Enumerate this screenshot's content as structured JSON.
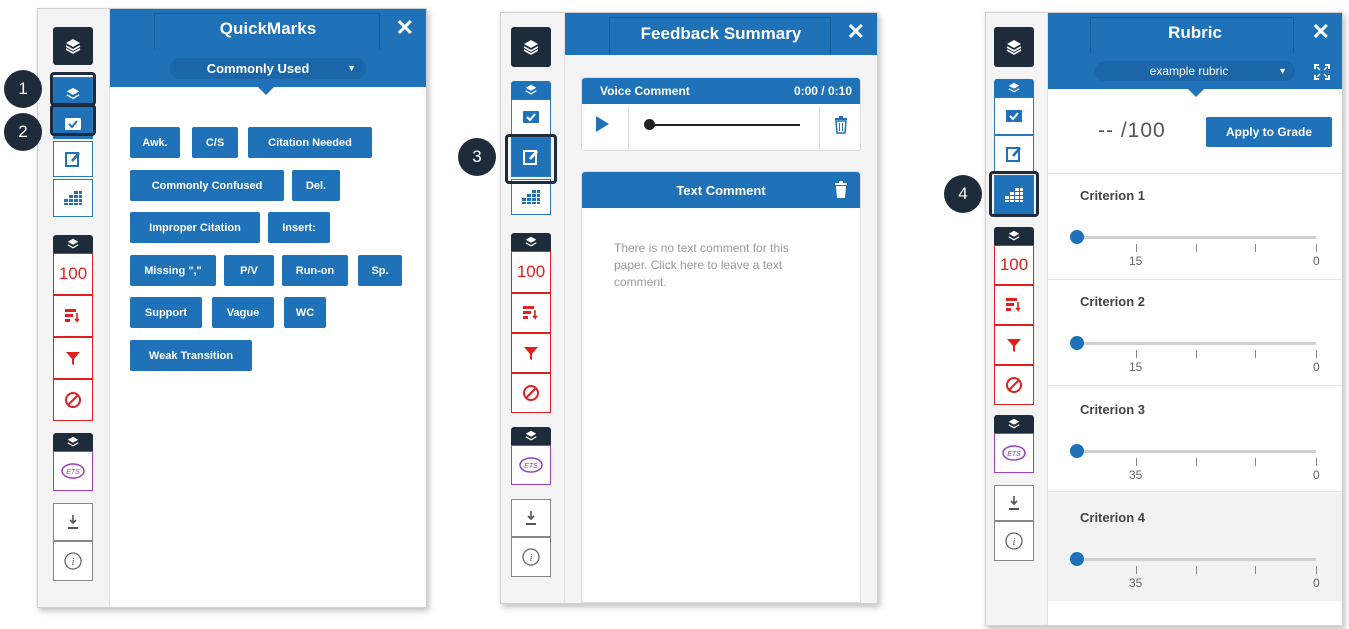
{
  "colors": {
    "accent": "#1f71b8",
    "dark": "#1e2b3a",
    "red": "#e02020",
    "purple": "#9b3fbf"
  },
  "annotations": [
    "1",
    "2",
    "3",
    "4"
  ],
  "rail": {
    "score_label": "100",
    "ets_label": "ETS"
  },
  "quickmarks": {
    "title": "QuickMarks",
    "set_selector": "Commonly Used",
    "marks": [
      "Awk.",
      "C/S",
      "Citation Needed",
      "Commonly Confused",
      "Del.",
      "Improper Citation",
      "Insert:",
      "Missing \",\"",
      "P/V",
      "Run-on",
      "Sp.",
      "Support",
      "Vague",
      "WC",
      "Weak Transition"
    ]
  },
  "feedback": {
    "title": "Feedback Summary",
    "voice": {
      "label": "Voice Comment",
      "time": "0:00 / 0:10"
    },
    "text": {
      "label": "Text Comment",
      "empty_message": "There is no text comment for this paper. Click here to leave a text comment."
    }
  },
  "rubric": {
    "title": "Rubric",
    "selector": "example rubric",
    "score": "-- /100",
    "apply_button": "Apply to Grade",
    "criteria": [
      {
        "name": "Criterion 1",
        "max": "15",
        "min": "0"
      },
      {
        "name": "Criterion 2",
        "max": "15",
        "min": "0"
      },
      {
        "name": "Criterion 3",
        "max": "35",
        "min": "0"
      },
      {
        "name": "Criterion 4",
        "max": "35",
        "min": "0"
      }
    ]
  }
}
